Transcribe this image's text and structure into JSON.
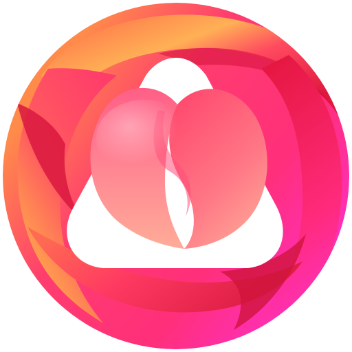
{
  "app_icon": {
    "icon_name": "peach-heart-swirl-logo",
    "colors": {
      "background": "#ffffff",
      "ring_magenta": "#ff2fd0",
      "ring_crimson": "#e0183f",
      "ring_pink": "#ff3d74",
      "ring_orange": "#ff8a4a",
      "ring_yellow": "#ffc550",
      "heart_light": "#ffb39c",
      "heart_mid": "#ff6f82",
      "heart_dark": "#f03c5e",
      "inner_frame": "#ffffff"
    }
  }
}
